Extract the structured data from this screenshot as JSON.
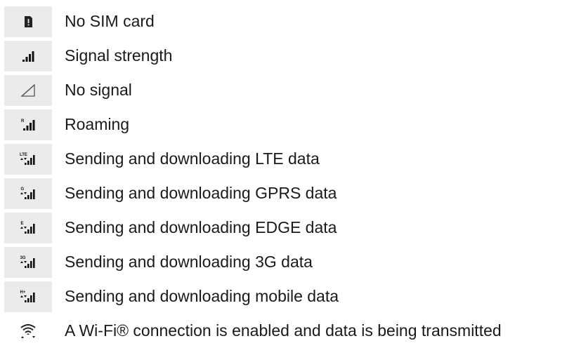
{
  "legend": {
    "rows": [
      {
        "icon": "no-sim-card-icon",
        "label": "No SIM card"
      },
      {
        "icon": "signal-strength-icon",
        "label": "Signal strength"
      },
      {
        "icon": "no-signal-icon",
        "label": "No signal"
      },
      {
        "icon": "roaming-icon",
        "label": "Roaming",
        "badge": "R"
      },
      {
        "icon": "lte-data-icon",
        "label": "Sending and downloading LTE data",
        "badge": "LTE"
      },
      {
        "icon": "gprs-data-icon",
        "label": "Sending and downloading GPRS data",
        "badge": "G"
      },
      {
        "icon": "edge-data-icon",
        "label": "Sending and downloading EDGE data",
        "badge": "E"
      },
      {
        "icon": "3g-data-icon",
        "label": "Sending and downloading 3G data",
        "badge": "3G"
      },
      {
        "icon": "mobile-data-icon",
        "label": "Sending and downloading mobile data",
        "badge": "H+"
      },
      {
        "icon": "wifi-data-icon",
        "label": "A Wi-Fi® connection is enabled and data is being transmitted"
      }
    ]
  },
  "colors": {
    "icon_cell_bg": "#ebebeb",
    "icon_fill": "#111111",
    "text": "#1a1a1a"
  }
}
